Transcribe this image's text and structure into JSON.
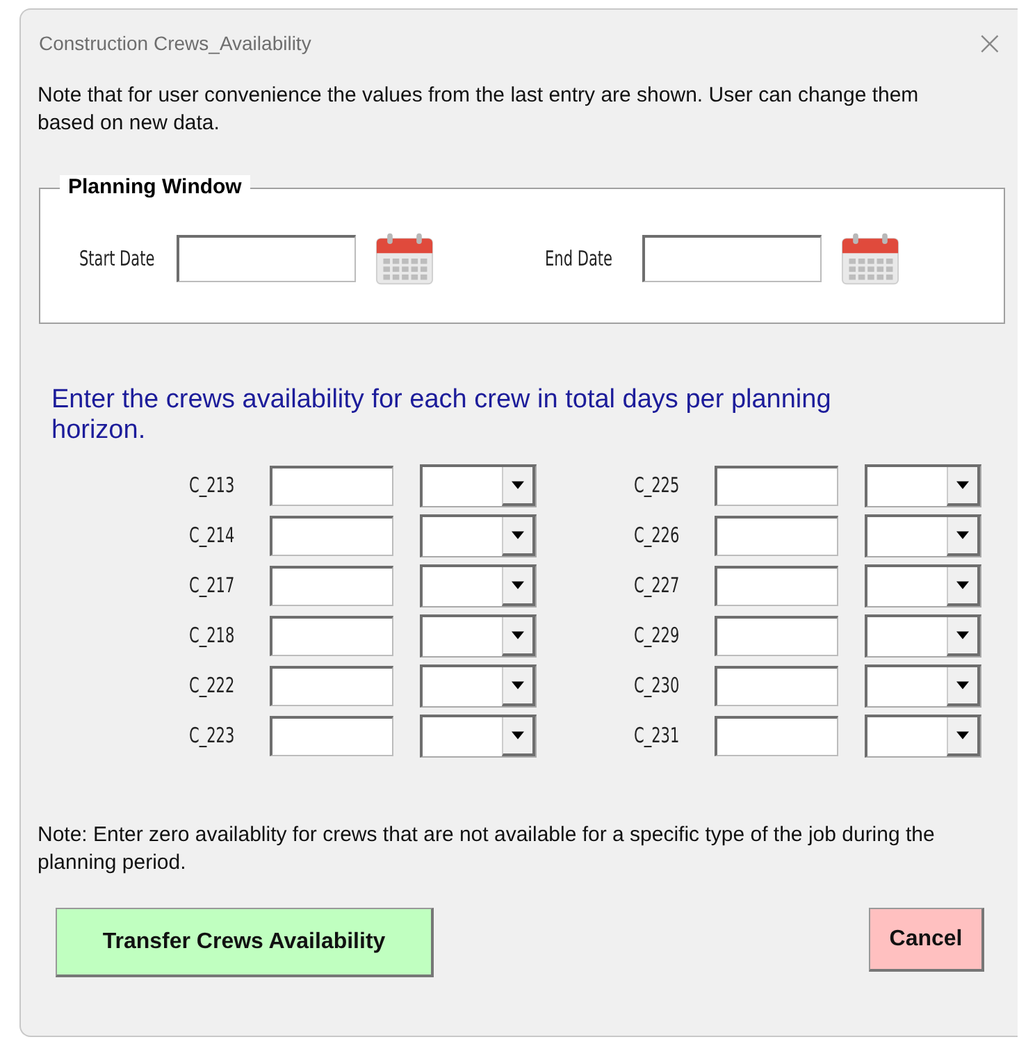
{
  "window": {
    "title": "Construction Crews_Availability",
    "close": "×"
  },
  "note": "Note that for user convenience the values from the last entry are shown.  User can change them based on new data.",
  "planning_window": {
    "title": "Planning Window",
    "fields": [
      {
        "label": "Start Date"
      },
      {
        "label": "End Date"
      }
    ]
  },
  "prompt": "Enter the crews availability for each crew in total days per planning horizon.",
  "crews": [
    {
      "label": "C_213"
    },
    {
      "label": "C_214"
    },
    {
      "label": "C_217"
    },
    {
      "label": "C_218"
    },
    {
      "label": "C_222"
    },
    {
      "label": "C_223"
    },
    {
      "label": "C_225"
    },
    {
      "label": "C_226"
    },
    {
      "label": "C_227"
    },
    {
      "label": "C_229"
    },
    {
      "label": "C_230"
    },
    {
      "label": "C_231"
    }
  ],
  "footer_note": "Note: Enter zero availablity for crews that are not available for a specific type of the job during the planning period.",
  "buttons": [
    {
      "label": "Transfer Crews Availability",
      "kind": "confirm"
    },
    {
      "label": "Cancel",
      "kind": "cancel"
    }
  ]
}
